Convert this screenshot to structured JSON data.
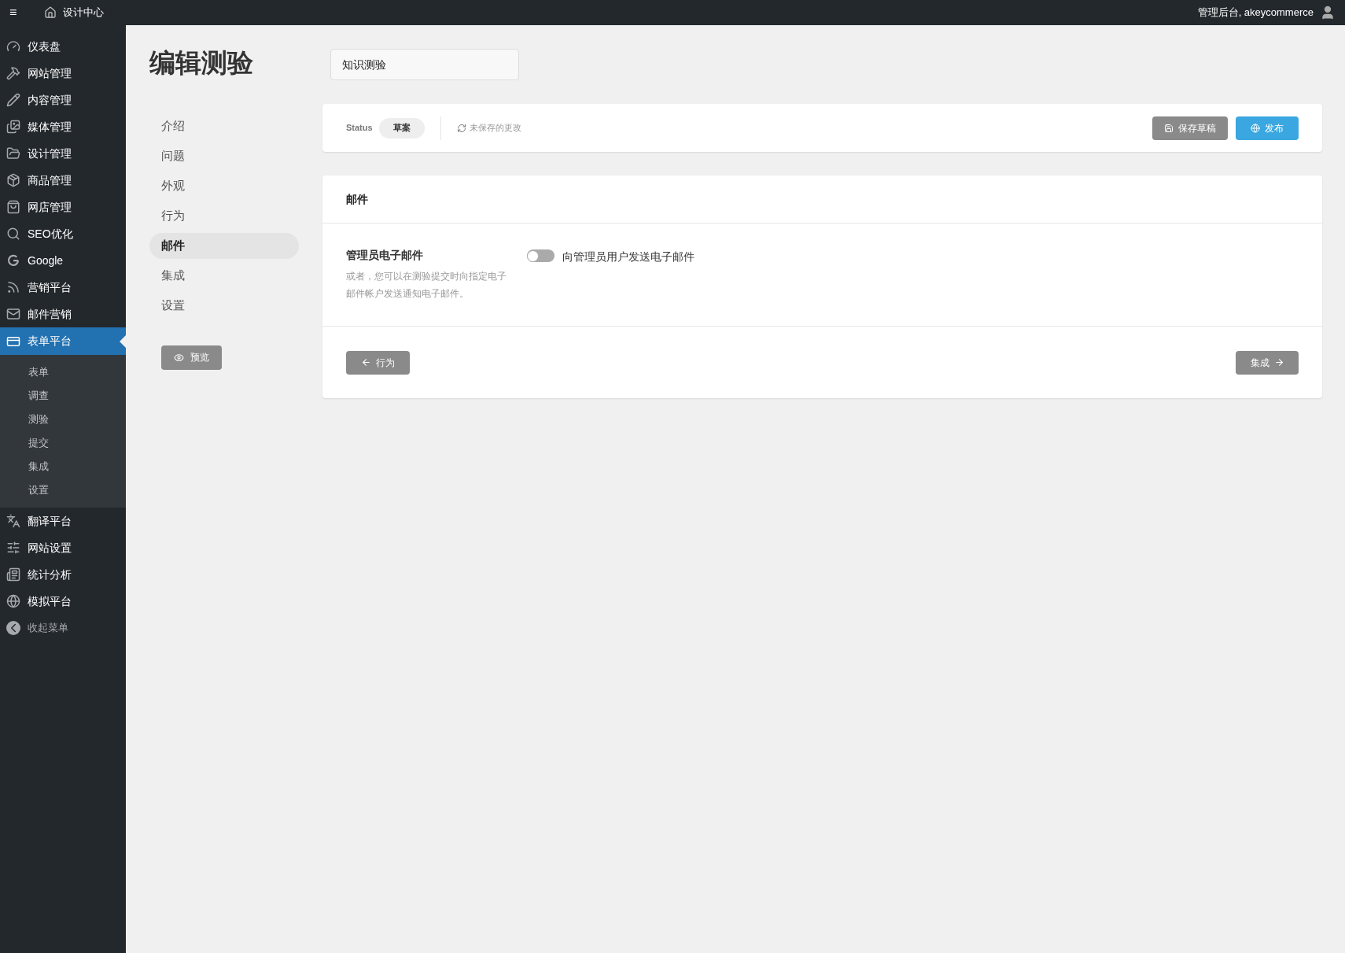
{
  "top_bar": {
    "menu_glyph": "≡",
    "site": "设计中心",
    "greeting": "管理后台, akeycommerce"
  },
  "sidebar": {
    "items": [
      {
        "label": "仪表盘",
        "selected": false
      },
      {
        "label": "网站管理",
        "selected": false
      },
      {
        "label": "内容管理",
        "selected": false
      },
      {
        "label": "媒体管理",
        "selected": false
      },
      {
        "label": "设计管理",
        "selected": false
      },
      {
        "label": "商品管理",
        "selected": false
      },
      {
        "label": "网店管理",
        "selected": false
      },
      {
        "label": "SEO优化",
        "selected": false
      },
      {
        "label": "Google",
        "selected": false
      },
      {
        "label": "营销平台",
        "selected": false
      },
      {
        "label": "邮件营销",
        "selected": false
      },
      {
        "label": "表单平台",
        "selected": true,
        "children": [
          {
            "label": "表单"
          },
          {
            "label": "调查"
          },
          {
            "label": "测验"
          },
          {
            "label": "提交"
          },
          {
            "label": "集成"
          },
          {
            "label": "设置"
          }
        ]
      },
      {
        "label": "翻译平台",
        "selected": false
      },
      {
        "label": "网站设置",
        "selected": false
      },
      {
        "label": "统计分析",
        "selected": false
      },
      {
        "label": "模拟平台",
        "selected": false
      }
    ],
    "collapse": "收起菜单"
  },
  "page_title": "编辑测验",
  "quiz_title": {
    "value": "知识测验"
  },
  "steps": [
    {
      "label": "介绍",
      "selected": false
    },
    {
      "label": "问题",
      "selected": false
    },
    {
      "label": "外观",
      "selected": false
    },
    {
      "label": "行为",
      "selected": false
    },
    {
      "label": "邮件",
      "selected": true
    },
    {
      "label": "集成",
      "selected": false
    },
    {
      "label": "设置",
      "selected": false
    }
  ],
  "preview_button": "预览",
  "status_bar": {
    "label": "Status",
    "status": "草案",
    "unsaved": "未保存的更改",
    "save_button": "保存草稿",
    "publish_button": "发布"
  },
  "section": {
    "title": "邮件",
    "setting_title": "管理员电子邮件",
    "setting_help": "或者，您可以在测验提交时向指定电子邮件帐户发送通知电子邮件。",
    "toggle": {
      "label": "向管理员用户发送电子邮件",
      "on": false
    },
    "back_button": "行为",
    "next_button": "集成"
  }
}
